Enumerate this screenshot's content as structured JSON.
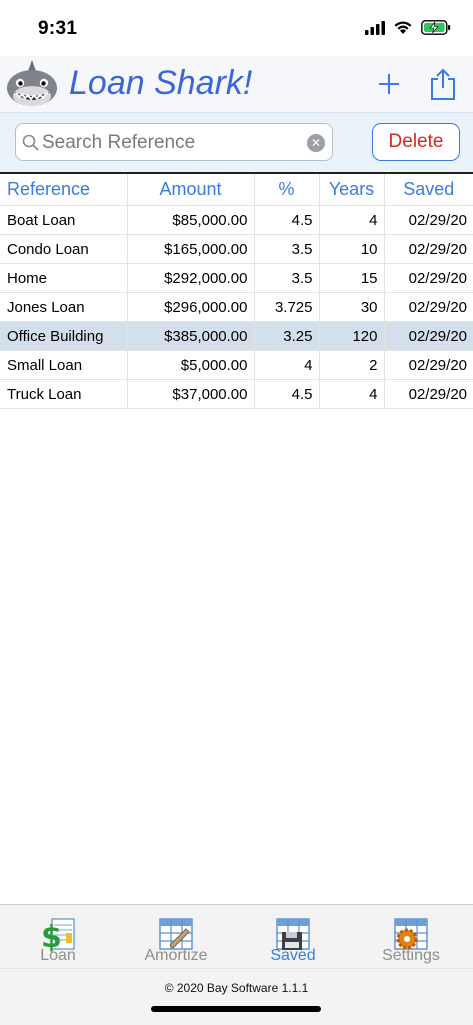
{
  "status_bar": {
    "time": "9:31"
  },
  "header": {
    "title": "Loan Shark!",
    "add_icon": "plus-icon",
    "share_icon": "share-icon"
  },
  "search": {
    "placeholder": "Search Reference",
    "value": "",
    "delete_label": "Delete"
  },
  "table": {
    "columns": [
      "Reference",
      "Amount",
      "%",
      "Years",
      "Saved"
    ],
    "rows": [
      {
        "reference": "Boat Loan",
        "amount": "$85,000.00",
        "rate": "4.5",
        "years": "4",
        "saved": "02/29/20"
      },
      {
        "reference": "Condo Loan",
        "amount": "$165,000.00",
        "rate": "3.5",
        "years": "10",
        "saved": "02/29/20"
      },
      {
        "reference": "Home",
        "amount": "$292,000.00",
        "rate": "3.5",
        "years": "15",
        "saved": "02/29/20"
      },
      {
        "reference": "Jones Loan",
        "amount": "$296,000.00",
        "rate": "3.725",
        "years": "30",
        "saved": "02/29/20"
      },
      {
        "reference": "Office Building",
        "amount": "$385,000.00",
        "rate": "3.25",
        "years": "120",
        "saved": "02/29/20"
      },
      {
        "reference": "Small Loan",
        "amount": "$5,000.00",
        "rate": "4",
        "years": "2",
        "saved": "02/29/20"
      },
      {
        "reference": "Truck Loan",
        "amount": "$37,000.00",
        "rate": "4.5",
        "years": "4",
        "saved": "02/29/20"
      }
    ],
    "selected_row_index": 4
  },
  "tabs": [
    {
      "label": "Loan",
      "icon": "dollar-sheet-icon"
    },
    {
      "label": "Amortize",
      "icon": "grid-pencil-icon"
    },
    {
      "label": "Saved",
      "icon": "grid-disk-icon"
    },
    {
      "label": "Settings",
      "icon": "grid-gear-icon"
    }
  ],
  "active_tab": "Saved",
  "footer": {
    "text": "© 2020 Bay Software 1.1.1"
  },
  "colors": {
    "accent": "#3a7be0",
    "title": "#3a66d8",
    "delete": "#d8261d",
    "selected_row": "#d3e0ec"
  }
}
